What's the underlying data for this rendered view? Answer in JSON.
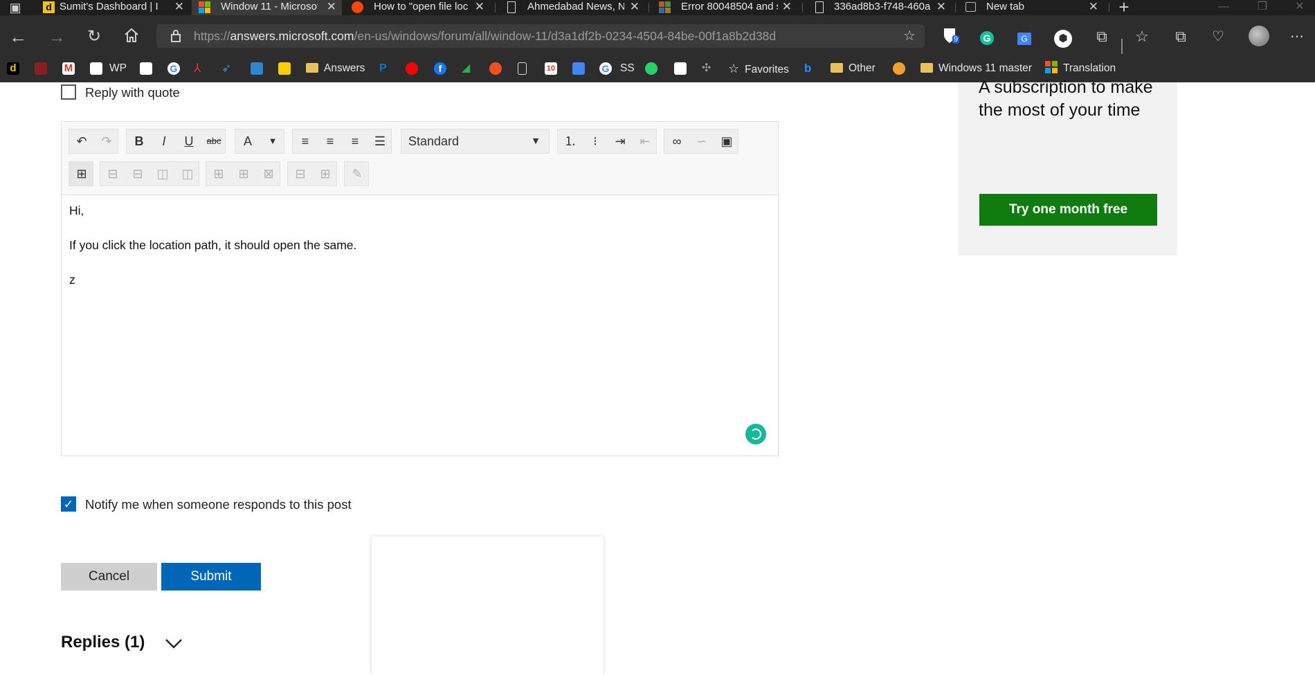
{
  "tabs": [
    {
      "title": "Sumit's Dashboard | I",
      "icon": "dashboard-d-icon",
      "active": false
    },
    {
      "title": "Window 11 - Microsof",
      "icon": "microsoft-logo-icon",
      "active": true
    },
    {
      "title": "How to \"open file loc",
      "icon": "reddit-icon",
      "active": false
    },
    {
      "title": "Ahmedabad News, N",
      "icon": "page-icon",
      "active": false
    },
    {
      "title": "Error 80048504 and s",
      "icon": "microsoft-logo-icon",
      "active": false
    },
    {
      "title": "336ad8b3-f748-460a",
      "icon": "page-icon",
      "active": false
    },
    {
      "title": "New tab",
      "icon": "new-tab-icon",
      "active": false
    }
  ],
  "address_bar": {
    "url_prefix": "https://",
    "url_domain": "answers.microsoft.com",
    "url_path": "/en-us/windows/forum/all/window-11/d3a1df2b-0234-4504-84be-00f1a8b2d38d"
  },
  "extensions": {
    "bitwarden_badge": "9"
  },
  "bookmarks": [
    {
      "label": "",
      "icon": "d-icon"
    },
    {
      "label": "",
      "icon": "rss-icon"
    },
    {
      "label": "",
      "icon": "gmail-icon"
    },
    {
      "label": "WP",
      "icon": "wp-icon"
    },
    {
      "label": "",
      "icon": "page-icon"
    },
    {
      "label": "",
      "icon": "google-icon"
    },
    {
      "label": "",
      "icon": "adobe-icon"
    },
    {
      "label": "",
      "icon": "bird-icon"
    },
    {
      "label": "",
      "icon": "sbi-icon"
    },
    {
      "label": "",
      "icon": "flipkart-icon"
    },
    {
      "label": "Answers",
      "icon": "folder-icon"
    },
    {
      "label": "",
      "icon": "paypal-icon"
    },
    {
      "label": "",
      "icon": "youtube-icon"
    },
    {
      "label": "",
      "icon": "facebook-icon"
    },
    {
      "label": "",
      "icon": "feedly-icon"
    },
    {
      "label": "",
      "icon": "sun-icon"
    },
    {
      "label": "",
      "icon": "page-icon"
    },
    {
      "label": "",
      "icon": "calendar-icon"
    },
    {
      "label": "",
      "icon": "translate-icon"
    },
    {
      "label": "SS",
      "icon": "google-icon"
    },
    {
      "label": "",
      "icon": "whatsapp-icon"
    },
    {
      "label": "",
      "icon": "pocket-icon"
    },
    {
      "label": "",
      "icon": "pixel-icon"
    },
    {
      "label": "Favorites",
      "icon": "star-icon"
    },
    {
      "label": "",
      "icon": "bing-icon"
    },
    {
      "label": "Other",
      "icon": "folder-icon"
    },
    {
      "label": "",
      "icon": "avatar-icon"
    },
    {
      "label": "Windows 11 master",
      "icon": "folder-icon"
    },
    {
      "label": "Translation",
      "icon": "microsoft-logo-icon"
    }
  ],
  "reply": {
    "quote_label": "Reply with quote",
    "format_select": "Standard",
    "body_lines": [
      "Hi,",
      "If you click the location path, it should open the same.",
      "z"
    ],
    "notify_label": "Notify me when someone responds to this post",
    "notify_checked": true,
    "cancel_label": "Cancel",
    "submit_label": "Submit"
  },
  "replies": {
    "heading": "Replies (1)"
  },
  "ad": {
    "text": "A subscription to make the most of your time",
    "button_label": "Try one month free"
  },
  "colors": {
    "accent": "#0067b8",
    "ad_button": "#107c10",
    "spinner": "#17b897"
  }
}
